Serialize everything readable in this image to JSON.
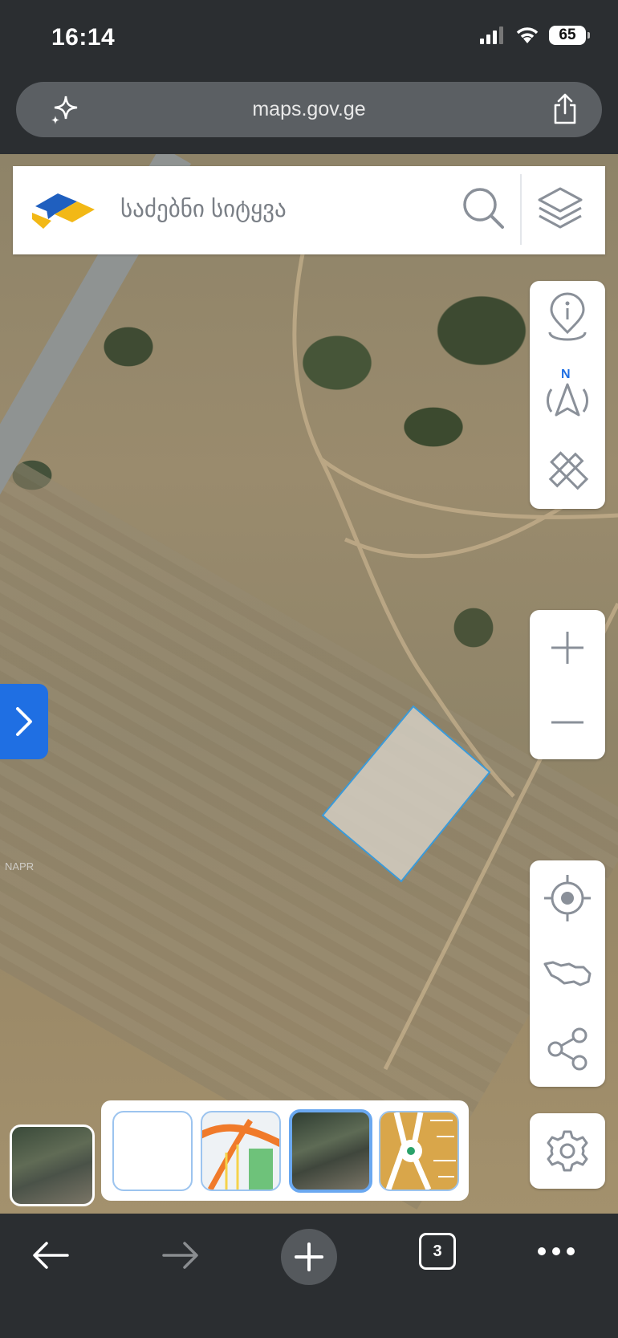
{
  "status_bar": {
    "time": "16:14",
    "battery": "65"
  },
  "browser": {
    "url": "maps.gov.ge",
    "tab_count": "3"
  },
  "search": {
    "placeholder": "საძებნი სიტყვა"
  },
  "map": {
    "watermark": "NAPR"
  },
  "colors": {
    "accent": "#1f6fe3",
    "icon": "#8a9099",
    "parcel_stroke": "#3a9ad9",
    "browser_chrome": "#2b2e31"
  },
  "icons": {
    "top_tools": [
      "info-pin-icon",
      "north-compass-icon",
      "measure-ruler-pencil-icon"
    ],
    "zoom": [
      "zoom-in-icon",
      "zoom-out-icon"
    ],
    "bottom_tools": [
      "locate-me-icon",
      "georgia-extent-icon",
      "share-icon"
    ],
    "settings": "gear-icon"
  },
  "basemaps": {
    "items": [
      "blank",
      "street",
      "satellite",
      "cadastre"
    ],
    "selected": "satellite"
  }
}
